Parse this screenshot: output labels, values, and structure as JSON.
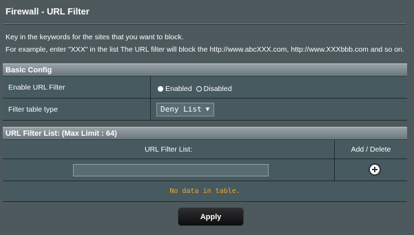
{
  "page": {
    "title": "Firewall - URL Filter",
    "description_line1": "Key in the keywords for the sites that you want to block.",
    "description_line2": "For example, enter \"XXX\" in the list The URL filter will block the http://www.abcXXX.com, http://www.XXXbbb.com and so on."
  },
  "basic_config": {
    "heading": "Basic Config",
    "enable_label": "Enable URL Filter",
    "enable_options": [
      "Enabled",
      "Disabled"
    ],
    "enable_selected": "Enabled",
    "filter_type_label": "Filter table type",
    "filter_type_value": "Deny List"
  },
  "url_list": {
    "heading": "URL Filter List: (Max Limit : 64)",
    "col_url": "URL Filter List:",
    "col_action": "Add / Delete",
    "input_value": "",
    "empty_message": "No data in table."
  },
  "actions": {
    "apply_label": "Apply"
  },
  "icons": {
    "add": "plus-circle-icon",
    "select": "chevron-down-icon"
  },
  "colors": {
    "background": "#4d595d",
    "row": "#475a5f",
    "empty_text": "#f0a92a"
  }
}
